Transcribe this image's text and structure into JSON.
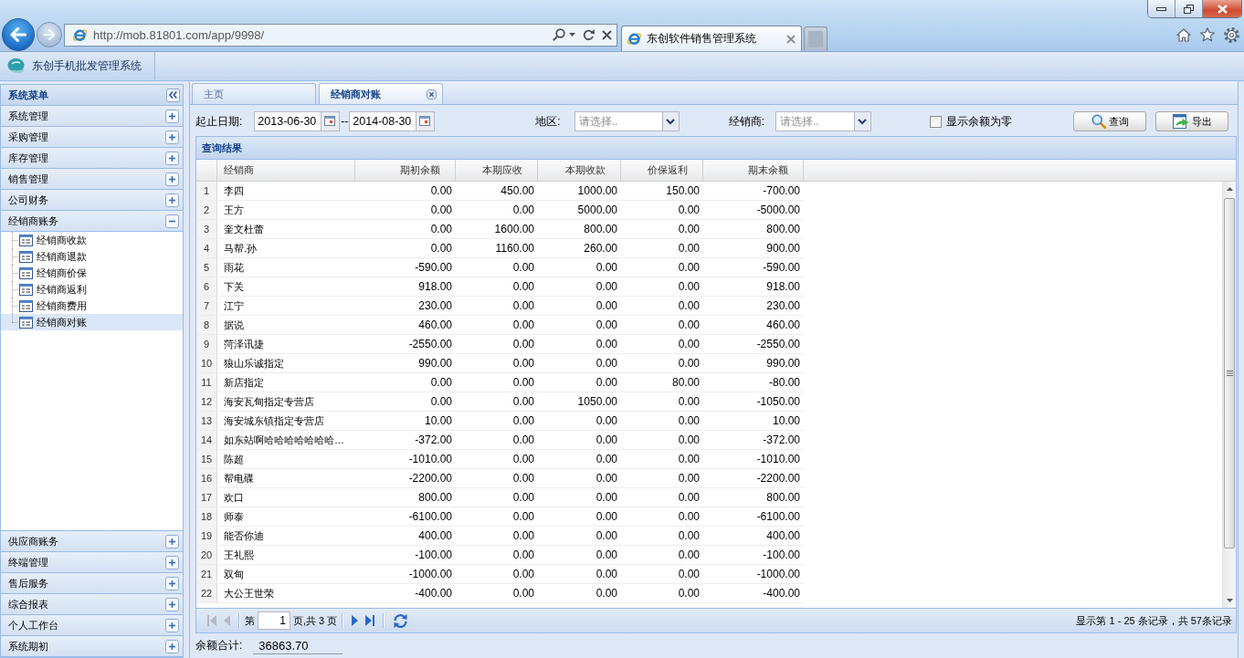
{
  "browser": {
    "address": "http://mob.81801.com/app/9998/",
    "tabs": [
      {
        "title": "东创软件销售管理系统",
        "selected": true
      },
      {
        "selected": false
      }
    ]
  },
  "app": {
    "title": "东创手机批发管理系统"
  },
  "sidebar": {
    "title": "系统菜单",
    "groups": [
      {
        "label": "系统管理",
        "expanded": false
      },
      {
        "label": "采购管理",
        "expanded": false
      },
      {
        "label": "库存管理",
        "expanded": false
      },
      {
        "label": "销售管理",
        "expanded": false
      },
      {
        "label": "公司财务",
        "expanded": false
      },
      {
        "label": "经销商账务",
        "expanded": true,
        "children": [
          {
            "label": "经销商收款",
            "selected": false
          },
          {
            "label": "经销商退款",
            "selected": false
          },
          {
            "label": "经销商价保",
            "selected": false
          },
          {
            "label": "经销商返利",
            "selected": false
          },
          {
            "label": "经销商费用",
            "selected": false
          },
          {
            "label": "经销商对账",
            "selected": true
          }
        ]
      },
      {
        "label": "供应商账务",
        "expanded": false
      },
      {
        "label": "终端管理",
        "expanded": false
      },
      {
        "label": "售后服务",
        "expanded": false
      },
      {
        "label": "综合报表",
        "expanded": false
      },
      {
        "label": "个人工作台",
        "expanded": false
      },
      {
        "label": "系统期初",
        "expanded": false
      }
    ]
  },
  "tabs": [
    {
      "label": "主页",
      "selected": false,
      "closable": false
    },
    {
      "label": "经销商对账",
      "selected": true,
      "closable": true
    }
  ],
  "filters": {
    "date_label": "起止日期:",
    "date_from": "2013-06-30",
    "date_separator": "--",
    "date_to": "2014-08-30",
    "region_label": "地区:",
    "region": {
      "placeholder": "请选择.."
    },
    "dealer_label": "经销商:",
    "dealer": {
      "placeholder": "请选择.."
    },
    "show_zero": {
      "label": "显示余额为零",
      "checked": false
    },
    "buttons": [
      {
        "label": "查询",
        "kind": "search"
      },
      {
        "label": "导出",
        "kind": "export"
      }
    ]
  },
  "results": {
    "title": "查询结果",
    "columns": [
      {
        "label": "经销商",
        "kind": "text"
      },
      {
        "label": "期初余额",
        "kind": "amount"
      },
      {
        "label": "本期应收",
        "kind": "amount"
      },
      {
        "label": "本期收款",
        "kind": "amount"
      },
      {
        "label": "价保返利",
        "kind": "amount"
      },
      {
        "label": "期末余额",
        "kind": "amount"
      }
    ],
    "rows": [
      {
        "number": "1",
        "cells": [
          "李四",
          "0.00",
          "450.00",
          "1000.00",
          "150.00",
          "-700.00"
        ]
      },
      {
        "number": "2",
        "cells": [
          "王方",
          "0.00",
          "0.00",
          "5000.00",
          "0.00",
          "-5000.00"
        ]
      },
      {
        "number": "3",
        "cells": [
          "奎文杜蕾",
          "0.00",
          "1600.00",
          "800.00",
          "0.00",
          "800.00"
        ]
      },
      {
        "number": "4",
        "cells": [
          "马帮.孙",
          "0.00",
          "1160.00",
          "260.00",
          "0.00",
          "900.00"
        ]
      },
      {
        "number": "5",
        "cells": [
          "雨花",
          "-590.00",
          "0.00",
          "0.00",
          "0.00",
          "-590.00"
        ]
      },
      {
        "number": "6",
        "cells": [
          "下关",
          "918.00",
          "0.00",
          "0.00",
          "0.00",
          "918.00"
        ]
      },
      {
        "number": "7",
        "cells": [
          "江宁",
          "230.00",
          "0.00",
          "0.00",
          "0.00",
          "230.00"
        ]
      },
      {
        "number": "8",
        "cells": [
          "据说",
          "460.00",
          "0.00",
          "0.00",
          "0.00",
          "460.00"
        ]
      },
      {
        "number": "9",
        "cells": [
          "菏泽讯捷",
          "-2550.00",
          "0.00",
          "0.00",
          "0.00",
          "-2550.00"
        ]
      },
      {
        "number": "10",
        "cells": [
          "狼山乐诚指定",
          "990.00",
          "0.00",
          "0.00",
          "0.00",
          "990.00"
        ]
      },
      {
        "number": "11",
        "cells": [
          "新店指定",
          "0.00",
          "0.00",
          "0.00",
          "80.00",
          "-80.00"
        ]
      },
      {
        "number": "12",
        "cells": [
          "海安瓦甸指定专营店",
          "0.00",
          "0.00",
          "1050.00",
          "0.00",
          "-1050.00"
        ]
      },
      {
        "number": "13",
        "cells": [
          "海安城东镇指定专营店",
          "10.00",
          "0.00",
          "0.00",
          "0.00",
          "10.00"
        ]
      },
      {
        "number": "14",
        "cells": [
          "如东站啊哈哈哈哈哈哈哈…",
          "-372.00",
          "0.00",
          "0.00",
          "0.00",
          "-372.00"
        ]
      },
      {
        "number": "15",
        "cells": [
          "陈超",
          "-1010.00",
          "0.00",
          "0.00",
          "0.00",
          "-1010.00"
        ]
      },
      {
        "number": "16",
        "cells": [
          "帮电碟",
          "-2200.00",
          "0.00",
          "0.00",
          "0.00",
          "-2200.00"
        ]
      },
      {
        "number": "17",
        "cells": [
          "欢口",
          "800.00",
          "0.00",
          "0.00",
          "0.00",
          "800.00"
        ]
      },
      {
        "number": "18",
        "cells": [
          "师泰",
          "-6100.00",
          "0.00",
          "0.00",
          "0.00",
          "-6100.00"
        ]
      },
      {
        "number": "19",
        "cells": [
          "能否你迪",
          "400.00",
          "0.00",
          "0.00",
          "0.00",
          "400.00"
        ]
      },
      {
        "number": "20",
        "cells": [
          "王礼熙",
          "-100.00",
          "0.00",
          "0.00",
          "0.00",
          "-100.00"
        ]
      },
      {
        "number": "21",
        "cells": [
          "双甸",
          "-1000.00",
          "0.00",
          "0.00",
          "0.00",
          "-1000.00"
        ]
      },
      {
        "number": "22",
        "cells": [
          "大公王世荣",
          "-400.00",
          "0.00",
          "0.00",
          "0.00",
          "-400.00"
        ]
      }
    ]
  },
  "pager": {
    "buttons": [
      {
        "kind": "first",
        "disabled": true
      },
      {
        "kind": "prev",
        "disabled": true
      },
      {
        "kind": "next",
        "disabled": false
      },
      {
        "kind": "last",
        "disabled": false
      },
      {
        "kind": "refresh",
        "disabled": false
      }
    ],
    "page_prefix": "第",
    "page": "1",
    "page_suffix": "页,共 3 页",
    "summary": "显示第 1 - 25 条记录，共 57条记录"
  },
  "total": {
    "label": "余额合计:",
    "value": "36863.70"
  }
}
